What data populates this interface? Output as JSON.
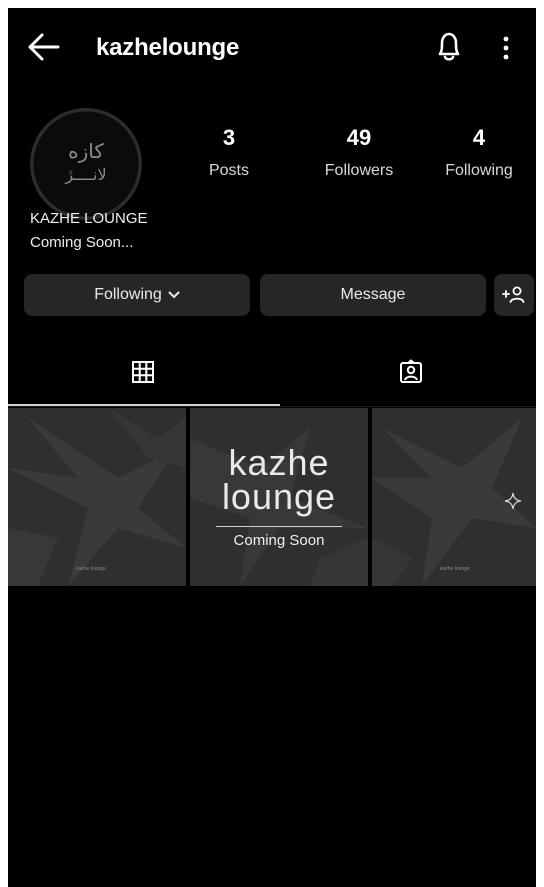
{
  "header": {
    "username": "kazhelounge",
    "icons": [
      "arrow-left-icon",
      "bell-icon",
      "more-vertical-icon"
    ]
  },
  "profile": {
    "display_name": "KAZHE LOUNGE",
    "bio": "Coming Soon...",
    "avatar_text_line1": "کازه",
    "avatar_text_line2": "لانــــژ"
  },
  "stats": [
    {
      "value": "3",
      "label": "Posts"
    },
    {
      "value": "49",
      "label": "Followers"
    },
    {
      "value": "4",
      "label": "Following"
    }
  ],
  "actions": {
    "following_label": "Following",
    "message_label": "Message",
    "add_icon": "add-person-icon"
  },
  "tabs": [
    {
      "icon": "grid-icon",
      "active": true
    },
    {
      "icon": "tagged-user-icon",
      "active": false
    }
  ],
  "posts": [
    {
      "caption": "kazhe lounge"
    },
    {
      "title_line1": "kazhe",
      "title_line2": "lounge",
      "subtitle": "Coming Soon"
    },
    {
      "caption": "kazhe lounge"
    }
  ],
  "colors": {
    "background": "#000000",
    "button": "#262626",
    "post_bg": "#2f2f2f",
    "text": "#ffffff"
  }
}
